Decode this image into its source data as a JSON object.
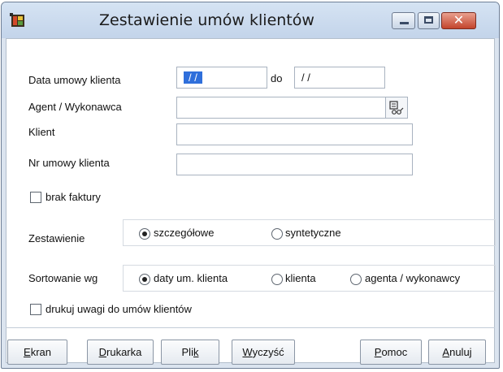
{
  "window": {
    "title": "Zestawienie umów klientów",
    "close_glyph": "✕",
    "app_icon": "report-icon"
  },
  "form": {
    "date_label": "Data umowy klienta",
    "date_from": "/ /",
    "date_to_label": "do",
    "date_to": "/ /",
    "agent_label": "Agent / Wykonawca",
    "agent_value": "",
    "client_label": "Klient",
    "client_value": "",
    "contract_no_label": "Nr umowy klienta",
    "contract_no_value": "",
    "no_invoice_label": "brak faktury",
    "no_invoice_checked": false,
    "report_type_label": "Zestawienie",
    "report_type_options": [
      "szczegółowe",
      "syntetyczne"
    ],
    "report_type_selected": "szczegółowe",
    "sort_label": "Sortowanie wg",
    "sort_options": [
      "daty um. klienta",
      "klienta",
      "agenta / wykonawcy"
    ],
    "sort_selected": "daty um. klienta",
    "print_notes_label": "drukuj uwagi do umów klientów",
    "print_notes_checked": false
  },
  "buttons": {
    "screen_first": "E",
    "screen_rest": "kran",
    "printer_first": "D",
    "printer_rest": "rukarka",
    "file_start": "Pli",
    "file_underlined": "k",
    "clear_first": "W",
    "clear_rest": "yczyść",
    "help_first": "P",
    "help_rest": "omoc",
    "cancel_first": "A",
    "cancel_rest": "nuluj"
  },
  "colors": {
    "selection": "#2f6fdb",
    "close_button": "#c3442c",
    "titlebar": "#c3d4ea"
  }
}
